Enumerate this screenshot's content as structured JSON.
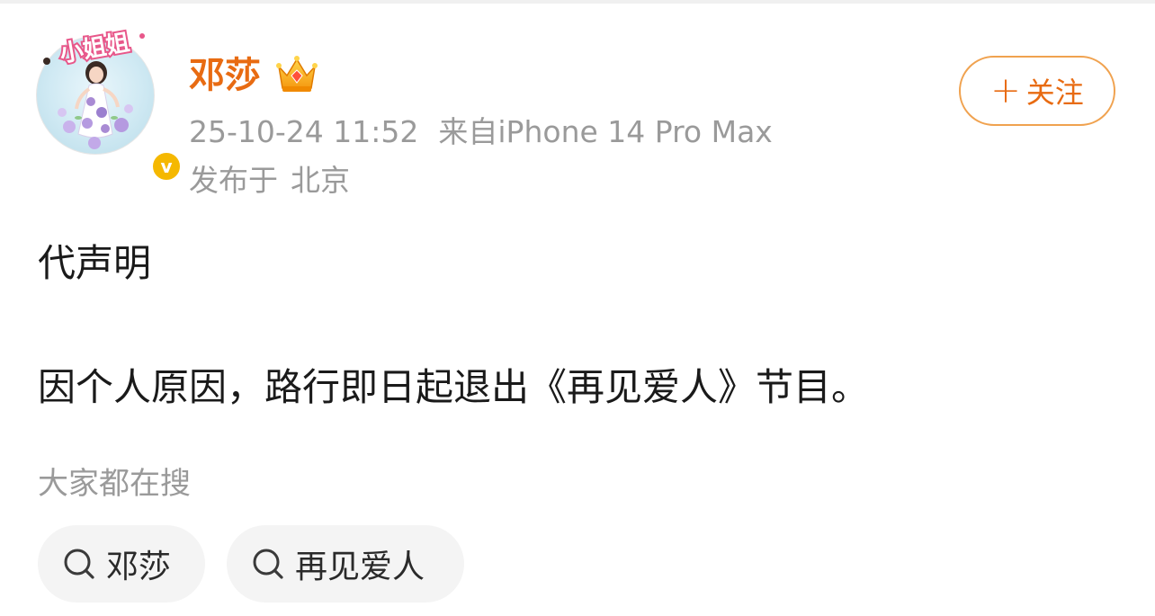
{
  "author": {
    "name": "邓莎",
    "avatar_tag_text": "小姐姐",
    "verified_mark": "v"
  },
  "post": {
    "timestamp": "25-10-24 11:52",
    "source": "来自iPhone 14 Pro Max",
    "location_label": "发布于",
    "location": "北京",
    "line1": "代声明",
    "line2": "因个人原因，路行即日起退出《再见爱人》节目。"
  },
  "follow_button": {
    "plus": "+",
    "label": "关注"
  },
  "trending": {
    "title": "大家都在搜",
    "chips": [
      {
        "label": "邓莎",
        "icon": "search-icon"
      },
      {
        "label": "再见爱人",
        "icon": "search-icon"
      }
    ]
  },
  "colors": {
    "accent": "#e86b12",
    "follow_border": "#f0a24f",
    "meta_text": "#9a9a9a",
    "chip_bg": "#f4f4f4",
    "verified": "#f5b800"
  }
}
